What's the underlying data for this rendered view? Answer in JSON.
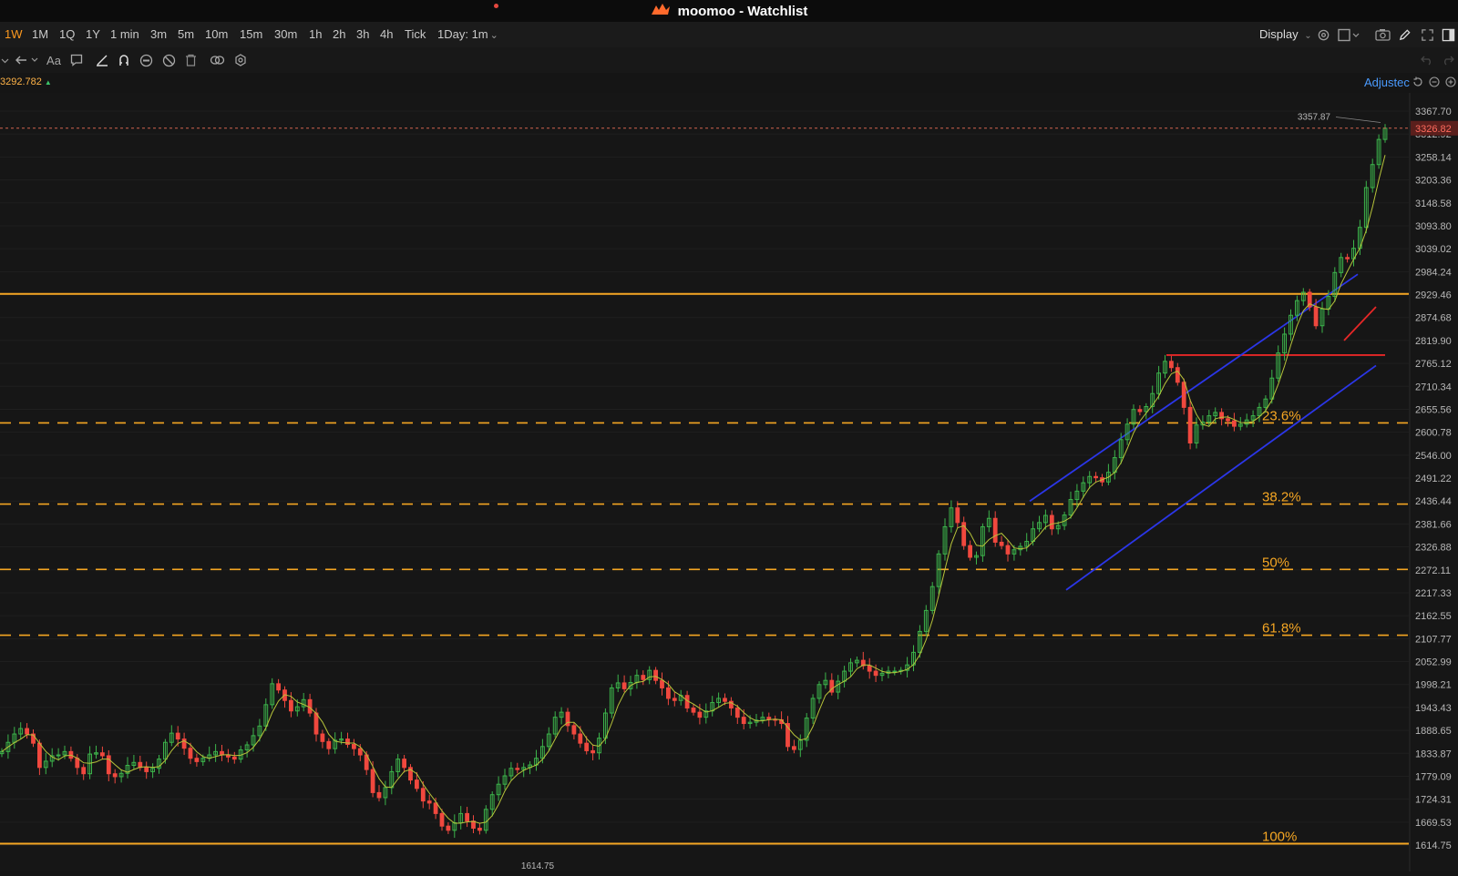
{
  "window": {
    "title": "moomoo - Watchlist"
  },
  "toolbar": {
    "timeframes": [
      "1W",
      "1M",
      "1Q",
      "1Y",
      "1 min",
      "3m",
      "5m",
      "10m",
      "15m",
      "30m",
      "1h",
      "2h",
      "3h",
      "4h",
      "Tick"
    ],
    "active_timeframe": "1W",
    "session_selector": "1Day: 1m",
    "display_label": "Display"
  },
  "info": {
    "last_price": "3292.782",
    "adjusted_label": "Adjustec"
  },
  "icons": [
    "chevron-down-icon",
    "arrow-left-icon",
    "text-icon",
    "comment-icon",
    "pen-icon",
    "magnet-icon",
    "lock-icon",
    "eye-off-icon",
    "trash-icon",
    "link-icon",
    "gear-icon",
    "camera-icon",
    "edit-icon",
    "fullscreen-icon",
    "panel-icon",
    "undo-icon",
    "redo-icon",
    "reset-icon",
    "zoom-out-icon",
    "zoom-in-icon"
  ],
  "colors": {
    "up": "#3cb44b",
    "down": "#f0483e",
    "fib": "#f5a623",
    "channel": "#2b36e8",
    "resistance": "#e62727",
    "current": "#d0634f"
  },
  "chart_data": {
    "type": "candlestick",
    "price_ticks": [
      "3367.70",
      "3312.92",
      "3258.14",
      "3203.36",
      "3148.58",
      "3093.80",
      "3039.02",
      "2984.24",
      "2929.46",
      "2874.68",
      "2819.90",
      "2765.12",
      "2710.34",
      "2655.56",
      "2600.78",
      "2546.00",
      "2491.22",
      "2436.44",
      "2381.66",
      "2326.88",
      "2272.11",
      "2217.33",
      "2162.55",
      "2107.77",
      "2052.99",
      "1998.21",
      "1943.43",
      "1888.65",
      "1833.87",
      "1779.09",
      "1724.31",
      "1669.53",
      "1614.75"
    ],
    "ylim": [
      1614.75,
      3367.7
    ],
    "current_price": "3326.82",
    "high_label": "3357.87",
    "low_label": "1614.75",
    "fib_levels": [
      {
        "label": "23.6%",
        "value": 2623
      },
      {
        "label": "38.2%",
        "value": 2429
      },
      {
        "label": "50%",
        "value": 2273
      },
      {
        "label": "61.8%",
        "value": 2116
      },
      {
        "label": "100%",
        "value": 1618
      }
    ],
    "support_line": 2931,
    "resistance_line": 2785,
    "closes": [
      1838,
      1860,
      1880,
      1893,
      1880,
      1858,
      1800,
      1815,
      1828,
      1830,
      1838,
      1822,
      1800,
      1785,
      1832,
      1835,
      1828,
      1785,
      1778,
      1786,
      1805,
      1812,
      1800,
      1790,
      1798,
      1820,
      1860,
      1882,
      1868,
      1846,
      1822,
      1814,
      1822,
      1830,
      1838,
      1830,
      1825,
      1820,
      1842,
      1854,
      1876,
      1899,
      1950,
      2000,
      1985,
      1960,
      1935,
      1945,
      1962,
      1930,
      1880,
      1862,
      1845,
      1865,
      1868,
      1855,
      1845,
      1830,
      1795,
      1740,
      1728,
      1752,
      1790,
      1820,
      1800,
      1770,
      1750,
      1720,
      1715,
      1690,
      1660,
      1650,
      1668,
      1690,
      1672,
      1655,
      1650,
      1700,
      1735,
      1760,
      1780,
      1798,
      1795,
      1800,
      1806,
      1822,
      1850,
      1880,
      1920,
      1932,
      1900,
      1880,
      1858,
      1840,
      1835,
      1870,
      1930,
      1990,
      2002,
      1988,
      2003,
      2020,
      2010,
      2032,
      2008,
      1990,
      1965,
      1960,
      1972,
      1942,
      1932,
      1920,
      1935,
      1955,
      1965,
      1958,
      1942,
      1920,
      1905,
      1908,
      1913,
      1920,
      1915,
      1914,
      1905,
      1850,
      1843,
      1865,
      1918,
      1965,
      1998,
      2008,
      1980,
      2006,
      2030,
      2050,
      2056,
      2043,
      2030,
      2020,
      2025,
      2030,
      2030,
      2032,
      2045,
      2075,
      2125,
      2175,
      2232,
      2310,
      2375,
      2420,
      2385,
      2330,
      2302,
      2306,
      2375,
      2395,
      2338,
      2330,
      2310,
      2320,
      2328,
      2340,
      2370,
      2385,
      2402,
      2370,
      2378,
      2403,
      2440,
      2460,
      2480,
      2495,
      2492,
      2482,
      2505,
      2540,
      2583,
      2620,
      2655,
      2650,
      2662,
      2693,
      2742,
      2770,
      2755,
      2720,
      2660,
      2575,
      2618,
      2625,
      2640,
      2648,
      2633,
      2628,
      2615,
      2620,
      2630,
      2640,
      2660,
      2680,
      2730,
      2790,
      2835,
      2880,
      2915,
      2935,
      2900,
      2855,
      2895,
      2925,
      2982,
      3018,
      3015,
      3040,
      3090,
      3185,
      3240,
      3300,
      3326.82
    ]
  }
}
